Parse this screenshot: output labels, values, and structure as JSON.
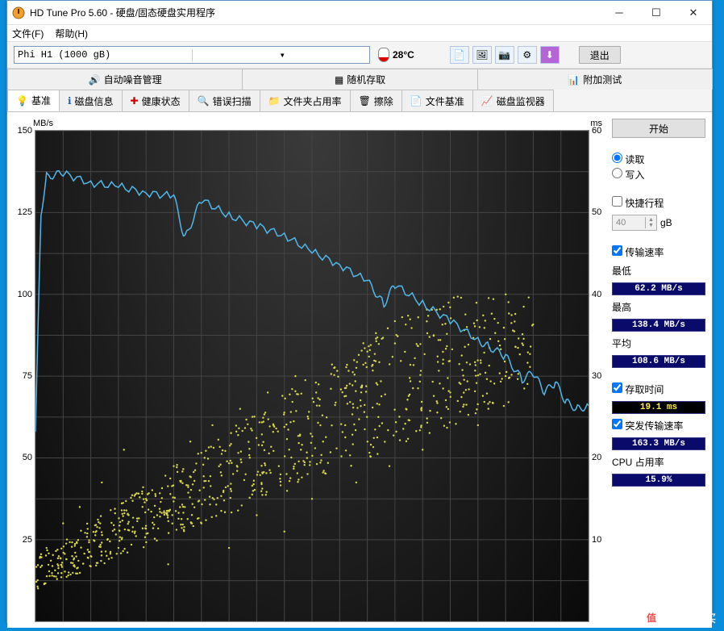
{
  "window": {
    "title": "HD Tune Pro 5.60 - 硬盘/固态硬盘实用程序"
  },
  "menubar": {
    "file": "文件(F)",
    "help": "帮助(H)"
  },
  "toolbar": {
    "drive": "Phi   H1 (1000 gB)",
    "temp": "28°C",
    "exit": "退出"
  },
  "tabs_top": {
    "noise": "自动噪音管理",
    "random": "随机存取",
    "extra": "附加测试"
  },
  "tabs_bottom": {
    "benchmark": "基准",
    "info": "磁盘信息",
    "health": "健康状态",
    "errorscan": "错误扫描",
    "folder": "文件夹占用率",
    "erase": "擦除",
    "filebm": "文件基准",
    "monitor": "磁盘监视器"
  },
  "chart": {
    "left_unit": "MB/s",
    "right_unit": "ms",
    "left_ticks": [
      "150",
      "125",
      "100",
      "75",
      "50",
      "25"
    ],
    "right_ticks": [
      "60",
      "50",
      "40",
      "30",
      "20",
      "10"
    ]
  },
  "chart_data": {
    "type": "line+scatter",
    "title": "",
    "x_range_pct": [
      0,
      100
    ],
    "left_axis": {
      "label": "MB/s",
      "range": [
        0,
        150
      ]
    },
    "right_axis": {
      "label": "ms",
      "range": [
        0,
        60
      ]
    },
    "transfer_rate_mbs": {
      "x_pct": [
        0,
        1,
        2,
        5,
        10,
        15,
        20,
        25,
        27,
        30,
        35,
        40,
        45,
        50,
        55,
        60,
        63,
        65,
        70,
        75,
        80,
        82,
        85,
        88,
        90,
        92,
        94,
        96,
        98,
        100
      ],
      "values": [
        58,
        125,
        136,
        137,
        134,
        133,
        131,
        130,
        117,
        129,
        124,
        121,
        118,
        113,
        109,
        104,
        97,
        103,
        97,
        92,
        86,
        84,
        81,
        74,
        76,
        70,
        73,
        67,
        65,
        66
      ]
    },
    "access_time_ms_scatter_sample": {
      "x_pct": [
        2,
        4,
        5,
        6,
        8,
        10,
        12,
        13,
        15,
        16,
        18,
        20,
        22,
        24,
        25,
        27,
        28,
        30,
        32,
        34,
        35,
        37,
        38,
        40,
        42,
        44,
        45,
        47,
        48,
        50,
        52,
        54,
        56,
        58,
        60,
        62,
        64,
        65,
        67,
        70,
        72,
        75,
        78,
        80,
        83,
        85,
        88
      ],
      "values": [
        9,
        7,
        12,
        6,
        14,
        8,
        17,
        10,
        9,
        21,
        11,
        15,
        13,
        7,
        19,
        14,
        22,
        12,
        24,
        16,
        9,
        26,
        18,
        13,
        28,
        19,
        11,
        30,
        21,
        15,
        22,
        31,
        24,
        17,
        33,
        25,
        19,
        34,
        26,
        21,
        35,
        28,
        36,
        24,
        37,
        30,
        34
      ]
    }
  },
  "side": {
    "start": "开始",
    "read": "读取",
    "write": "写入",
    "shortstroke": "快捷行程",
    "shortstroke_val": "40",
    "shortstroke_unit": "gB",
    "transfer_rate": "传输速率",
    "min_label": "最低",
    "min_val": "62.2 MB/s",
    "max_label": "最高",
    "max_val": "138.4 MB/s",
    "avg_label": "平均",
    "avg_val": "108.6 MB/s",
    "access_label": "存取时间",
    "access_val": "19.1 ms",
    "burst_label": "突发传输速率",
    "burst_val": "163.3 MB/s",
    "cpu_label": "CPU 占用率",
    "cpu_val": "15.9%"
  },
  "watermark": "什么值得买"
}
